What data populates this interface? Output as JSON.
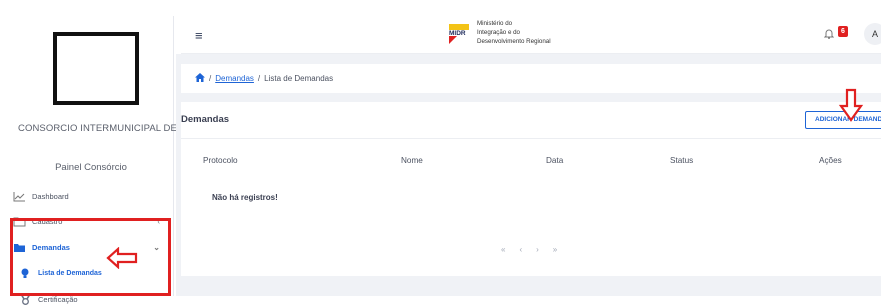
{
  "sidebar": {
    "org_name": "CONSORCIO INTERMUNICIPAL DE",
    "panel_title": "Painel Consórcio",
    "items": [
      {
        "label": "Dashboard",
        "icon": "chart-icon"
      },
      {
        "label": "Cadastro",
        "icon": "folder-icon",
        "chevron": "‹"
      },
      {
        "label": "Demandas",
        "icon": "folder-open-icon",
        "chevron": "⌄"
      },
      {
        "label": "Lista de Demandas",
        "icon": "bulb-icon"
      },
      {
        "label": "Certificação",
        "icon": "medal-icon"
      }
    ]
  },
  "topbar": {
    "menu_icon": "≡",
    "brand_logo_text": "MIDR",
    "brand_lines": [
      "Ministério do",
      "Integração e do",
      "Desenvolvimento Regional"
    ],
    "notification_count": "6",
    "avatar_initial": "A"
  },
  "breadcrumb": {
    "link": "Demandas",
    "separator": "/",
    "current": "Lista de Demandas"
  },
  "card": {
    "title": "Demandas",
    "add_button": "ADICIONAR DEMANDA",
    "columns": [
      "Protocolo",
      "Nome",
      "Data",
      "Status",
      "Ações"
    ],
    "empty_text": "Não há registros!",
    "pager": [
      "«",
      "‹",
      "›",
      "»"
    ]
  },
  "colors": {
    "accent": "#1e64d6",
    "annotation_red": "#e02020",
    "content_bg": "#f0f2f6"
  }
}
